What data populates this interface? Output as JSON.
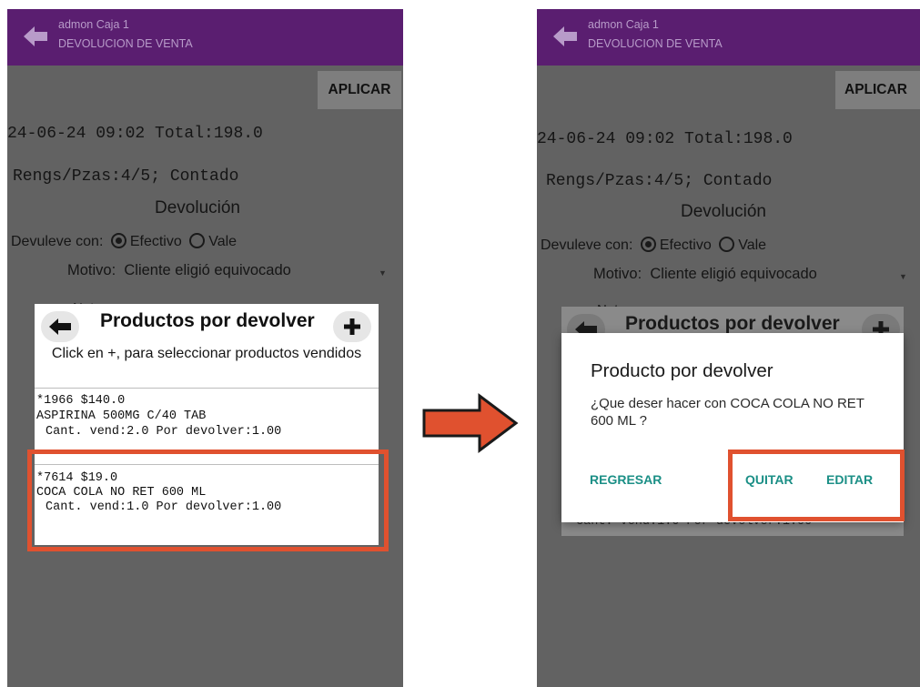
{
  "header": {
    "user_line": "admon Caja 1",
    "screen_title": "DEVOLUCION DE VENTA"
  },
  "toolbar": {
    "apply_label": "APLICAR"
  },
  "sale": {
    "date_total": "24-06-24 09:02 Total:198.0",
    "rows_pieces": "Rengs/Pzas:4/5; Contado"
  },
  "refund": {
    "section_title": "Devolución",
    "refund_with_label": "Devuleve con:",
    "option_cash": "Efectivo",
    "option_voucher": "Vale",
    "reason_label": "Motivo:",
    "reason_value": "Cliente eligió equivocado",
    "notes_label": "Notas:"
  },
  "products_dialog": {
    "title": "Productos por devolver",
    "hint": "Click en +, para seleccionar productos vendidos",
    "items": [
      {
        "line1": "*1966 $140.0",
        "line2": "ASPIRINA 500MG C/40 TAB",
        "line3": "Cant. vend:2.0 Por devolver:1.00"
      },
      {
        "line1": "*7614 $19.0",
        "line2": "COCA COLA NO RET 600 ML",
        "line3": "Cant. vend:1.0 Por devolver:1.00"
      }
    ]
  },
  "confirm_dialog": {
    "title": "Producto por devolver",
    "message": "¿Que deser hacer con COCA COLA NO RET 600 ML ?",
    "back_label": "REGRESAR",
    "remove_label": "QUITAR",
    "edit_label": "EDITAR",
    "behind_fragment": "Cant. vend:1.0 Por devolver:1.00"
  },
  "colors": {
    "app_bar": "#5a1e70",
    "dim_overlay": "#626262",
    "highlight": "#e0512f",
    "accent_button_text": "#1b8f86"
  }
}
